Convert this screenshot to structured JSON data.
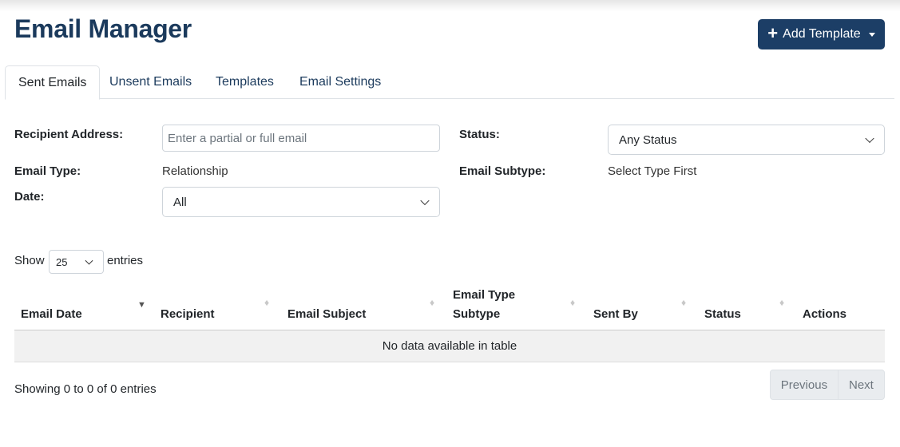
{
  "header": {
    "title": "Email Manager",
    "add_button_label": "Add Template"
  },
  "tabs": [
    {
      "label": "Sent Emails",
      "active": true
    },
    {
      "label": "Unsent Emails",
      "active": false
    },
    {
      "label": "Templates",
      "active": false
    },
    {
      "label": "Email Settings",
      "active": false
    }
  ],
  "filters": {
    "recipient_label": "Recipient Address:",
    "recipient_placeholder": "Enter a partial or full email",
    "status_label": "Status:",
    "status_value": "Any Status",
    "email_type_label": "Email Type:",
    "email_type_value": "Relationship",
    "email_subtype_label": "Email Subtype:",
    "email_subtype_value": "Select Type First",
    "date_label": "Date:",
    "date_value": "All"
  },
  "table": {
    "show_label": "Show",
    "page_length": "25",
    "entries_label": "entries",
    "columns": [
      "Email Date",
      "Recipient",
      "Email Subject",
      "Email Type Subtype",
      "Sent By",
      "Status",
      "Actions"
    ],
    "column_line1": "Email Type",
    "column_line2": "Subtype",
    "empty_message": "No data available in table",
    "info": "Showing 0 to 0 of 0 entries",
    "prev_label": "Previous",
    "next_label": "Next"
  },
  "colors": {
    "primary": "#1c3e66",
    "title": "#1b3a5c"
  },
  "icons": {
    "add": "plus-icon",
    "sort": "sort-arrows-icon",
    "dropdown": "chevron-down-icon"
  }
}
